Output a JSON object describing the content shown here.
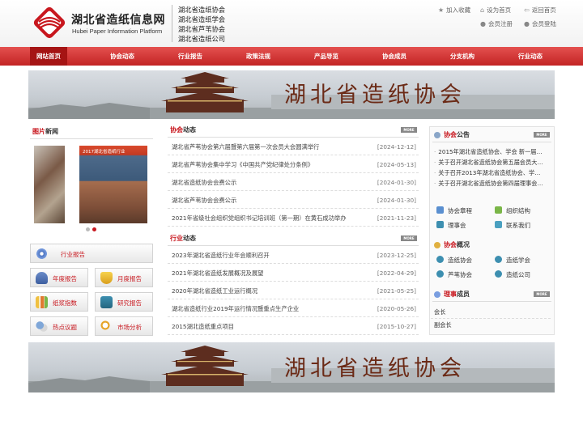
{
  "header": {
    "logo_cn": "湖北省造纸信息网",
    "logo_en": "Hubei Paper Information Platform",
    "associations": [
      "湖北省造纸协会",
      "湖北省造纸学会",
      "湖北省芦苇协会",
      "湖北省造纸公司"
    ],
    "links": {
      "bookmark": "加入收藏",
      "homepage": "设为首页",
      "back_home": "返回首页",
      "register": "会员注册",
      "login": "会员登陆"
    }
  },
  "nav": [
    "网站首页",
    "协会动态",
    "行业报告",
    "政策法规",
    "产品导览",
    "协会成员",
    "分支机构",
    "行业动态"
  ],
  "banner": {
    "text": "湖北省造纸协会"
  },
  "photo_news": {
    "title_red": "图片",
    "title_black": "新闻",
    "photo_caption": "2017湖北省造纸行业"
  },
  "left_buttons": {
    "industry_report": "行业报告",
    "annual": "年度报告",
    "monthly": "月度报告",
    "index": "纸浆指数",
    "research": "研究报告",
    "hot_topics": "热点议题",
    "market": "市场分析"
  },
  "more_label": "MORE",
  "assoc_news": {
    "title_red": "协会",
    "title_black": "动态",
    "items": [
      {
        "title": "湖北省芦苇协会第六届暨第六届第一次会员大会圆满举行",
        "date": "[2024-12-12]"
      },
      {
        "title": "湖北省芦苇协会集中学习《中国共产党纪律处分条例》",
        "date": "[2024-05-13]"
      },
      {
        "title": "湖北省造纸协会会费公示",
        "date": "[2024-01-30]"
      },
      {
        "title": "湖北省芦苇协会会费公示",
        "date": "[2024-01-30]"
      },
      {
        "title": "2021年省级社会组织党组织书记培训班（第一期）在黄石成功举办",
        "date": "[2021-11-23]"
      }
    ]
  },
  "industry_news": {
    "title_red": "行业",
    "title_black": "动态",
    "items": [
      {
        "title": "2023年湖北省造纸行业年会顺利召开",
        "date": "[2023-12-25]"
      },
      {
        "title": "2021年湖北省造纸发展概况及展望",
        "date": "[2022-04-29]"
      },
      {
        "title": "2020年湖北省造纸工业运行概况",
        "date": "[2021-05-25]"
      },
      {
        "title": "湖北省造纸行业2019年运行情况暨重点生产企业",
        "date": "[2020-05-26]"
      },
      {
        "title": "2015湖北造纸重点项目",
        "date": "[2015-10-27]"
      }
    ]
  },
  "notice": {
    "title_red": "协会",
    "title_black": "公告",
    "items": [
      "2015年湖北省造纸协会、学会 新一届…",
      "关于召开湖北省造纸协会第五届会员大…",
      "关于召开2013年湖北省造纸协会、学…",
      "关于召开湖北省造纸协会第四届理事会…"
    ],
    "links": [
      "协会章程",
      "组织结构",
      "理事会",
      "联系我们"
    ]
  },
  "overview": {
    "title_red": "协会",
    "title_black": "概况",
    "links": [
      "造纸协会",
      "造纸学会",
      "芦苇协会",
      "造纸公司"
    ]
  },
  "council": {
    "title_red": "理事",
    "title_black": "成员",
    "items": [
      "会长",
      "副会长"
    ]
  },
  "colors": {
    "primary_red": "#c8171e",
    "nav_gradient_top": "#e4514f",
    "nav_gradient_bottom": "#c32424"
  }
}
